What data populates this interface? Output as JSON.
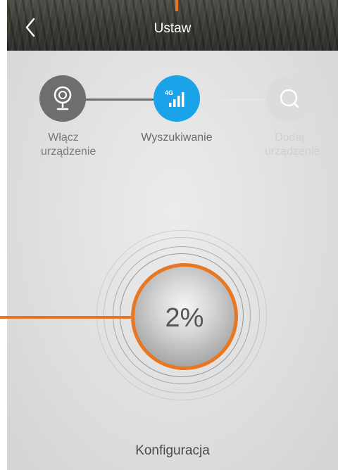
{
  "header": {
    "title": "Ustaw",
    "back_icon": "chevron-left-icon"
  },
  "steps": [
    {
      "label": "Włącz urządzenie",
      "icon": "camera-icon",
      "state": "done"
    },
    {
      "label": "Wyszukiwanie",
      "icon": "4g-signal-icon",
      "badge": "4G",
      "state": "active"
    },
    {
      "label": "Dodaj urządzenie",
      "icon": "search-icon",
      "state": "pending"
    }
  ],
  "progress": {
    "percent_text": "2%",
    "value": 2
  },
  "status": {
    "text": "Konfiguracja"
  },
  "colors": {
    "accent": "#e87722",
    "active": "#1aa3e8",
    "done": "#6e6e6e",
    "pending": "#dcdcdc"
  }
}
